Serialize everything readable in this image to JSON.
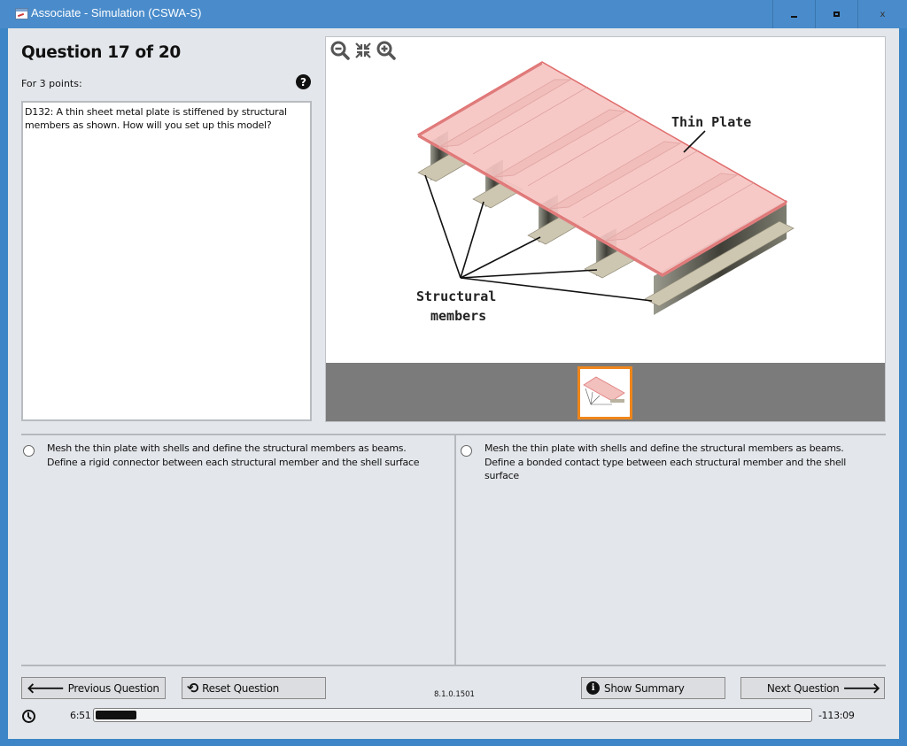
{
  "window": {
    "title": "Associate - Simulation (CSWA-S)",
    "controls": {
      "minimize": "–",
      "maximize": "□",
      "close": "x"
    }
  },
  "question": {
    "heading": "Question 17 of 20",
    "points": "For 3 points:",
    "text": "D132: A thin sheet metal plate is stiffened by structural members as shown. How will you set up this model?"
  },
  "image_viewer": {
    "tools": [
      "zoom-out-icon",
      "fit-to-window-icon",
      "zoom-in-icon"
    ],
    "figure": {
      "label_plate": "Thin Plate",
      "label_members_line1": "Structural",
      "label_members_line2": "members"
    },
    "thumbnails": [
      {
        "selected": true
      }
    ],
    "colors": {
      "plate": "#f5c2c0",
      "plate_edge": "#e06c6c",
      "thumb_border": "#f0861a",
      "strip": "#7b7b7b"
    }
  },
  "answers": [
    {
      "text": "Mesh the thin plate with shells and define the structural members as beams. Define a rigid connector between each structural member and the shell surface",
      "selected": false
    },
    {
      "text": "Mesh the thin plate with shells and define the structural members as beams. Define a bonded contact type between each structural member and the shell surface",
      "selected": false
    }
  ],
  "footer": {
    "previous_label": "Previous Question",
    "reset_label": "Reset Question",
    "version": "8.1.0.1501",
    "summary_label": "Show Summary",
    "next_label": "Next Question",
    "elapsed": "6:51",
    "remaining": "-113:09",
    "progress_fraction": 0.057
  }
}
